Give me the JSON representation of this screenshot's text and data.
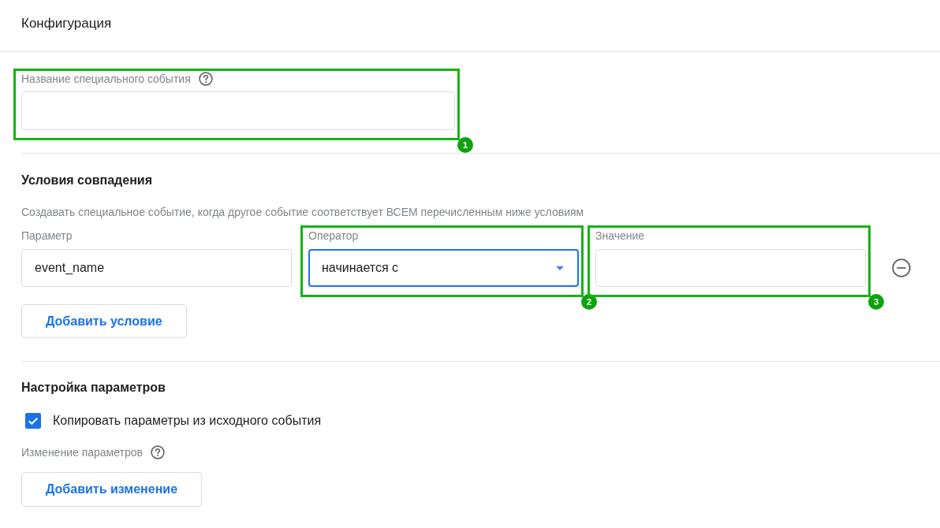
{
  "header": {
    "title": "Конфигурация"
  },
  "event_name": {
    "label": "Название специального события",
    "annotation": "1"
  },
  "matching_conditions": {
    "title": "Условия совпадения",
    "description": "Создавать специальное событие, когда другое событие соответствует ВСЕМ перечисленным ниже условиям",
    "conditions": [
      {
        "parameter": {
          "label": "Параметр",
          "value": "event_name"
        },
        "operator": {
          "label": "Оператор",
          "value": "начинается с",
          "focused": true,
          "annotation": "2"
        },
        "value": {
          "label": "Значение",
          "annotation": "3"
        }
      }
    ],
    "add_button": "Добавить условие"
  },
  "parameter_settings": {
    "title": "Настройка параметров",
    "copy_parameters": {
      "label": "Копировать параметры из исходного события",
      "checked": true
    },
    "modifications_label": "Изменение параметров",
    "add_button": "Добавить изменение"
  }
}
